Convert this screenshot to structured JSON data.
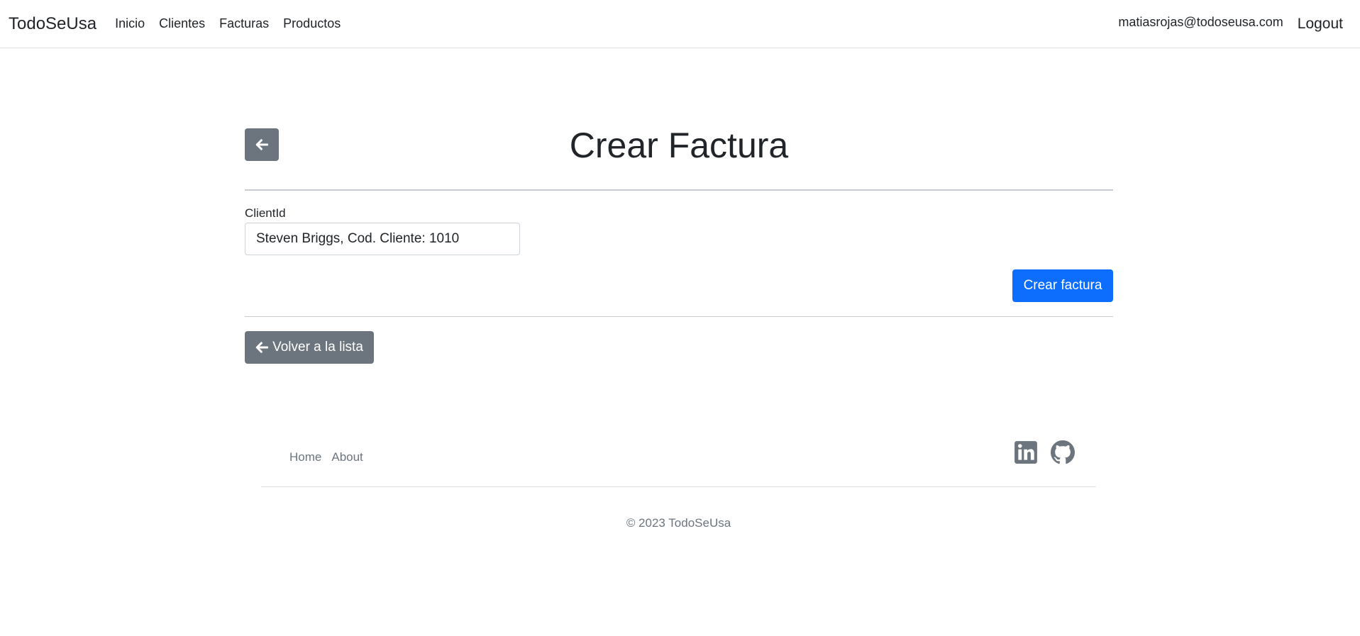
{
  "navbar": {
    "brand": "TodoSeUsa",
    "links": [
      "Inicio",
      "Clientes",
      "Facturas",
      "Productos"
    ],
    "user_email": "matiasrojas@todoseusa.com",
    "logout": "Logout"
  },
  "page": {
    "title": "Crear Factura",
    "back_icon": "arrow-left-icon"
  },
  "form": {
    "client_label": "ClientId",
    "client_value": "Steven Briggs, Cod. Cliente: 1010",
    "submit_label": "Crear factura"
  },
  "back_to_list": {
    "icon": "arrow-left-icon",
    "label": "Volver a la lista"
  },
  "footer": {
    "links": [
      "Home",
      "About"
    ],
    "socials": [
      "linkedin-icon",
      "github-icon"
    ],
    "copyright": "© 2023 TodoSeUsa"
  },
  "colors": {
    "primary": "#0d6efd",
    "secondary": "#6c757d",
    "text": "#212529"
  }
}
